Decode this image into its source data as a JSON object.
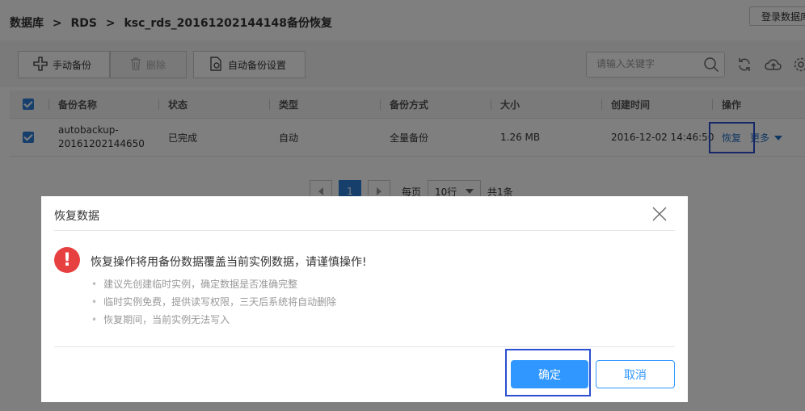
{
  "breadcrumb": {
    "part1": "数据库",
    "sep1": ">",
    "part2": "RDS",
    "sep2": ">",
    "part3": "ksc_rds_20161202144148备份恢复"
  },
  "top_right_button": "登录数据库",
  "toolbar": {
    "manual_backup": "手动备份",
    "delete": "删除",
    "auto_backup_settings": "自动备份设置",
    "search_placeholder": "请输入关键字"
  },
  "table": {
    "headers": [
      "备份名称",
      "状态",
      "类型",
      "备份方式",
      "大小",
      "创建时间",
      "操作"
    ],
    "rows": [
      {
        "name_line1": "autobackup-",
        "name_line2": "20161202144650",
        "status": "已完成",
        "type": "自动",
        "method": "全量备份",
        "size": "1.26 MB",
        "created": "2016-12-02 14:46:50",
        "action_restore": "恢复",
        "action_more": "更多"
      }
    ]
  },
  "pagination": {
    "current_page": "1",
    "per_page_label": "每页",
    "page_size": "10行",
    "total": "共1条"
  },
  "modal": {
    "title": "恢复数据",
    "warning": "恢复操作将用备份数据覆盖当前实例数据，请谨慎操作!",
    "tips": [
      "建议先创建临时实例，确定数据是否准确完整",
      "临时实例免费，提供读写权限，三天后系统将自动删除",
      "恢复期间，当前实例无法写入"
    ],
    "confirm": "确定",
    "cancel": "取消"
  },
  "colors": {
    "primary": "#2f97ff",
    "link": "#1f6fc5",
    "checkbox": "#2d7fd8",
    "warning": "#e64140",
    "highlight": "#2a4fd0"
  }
}
